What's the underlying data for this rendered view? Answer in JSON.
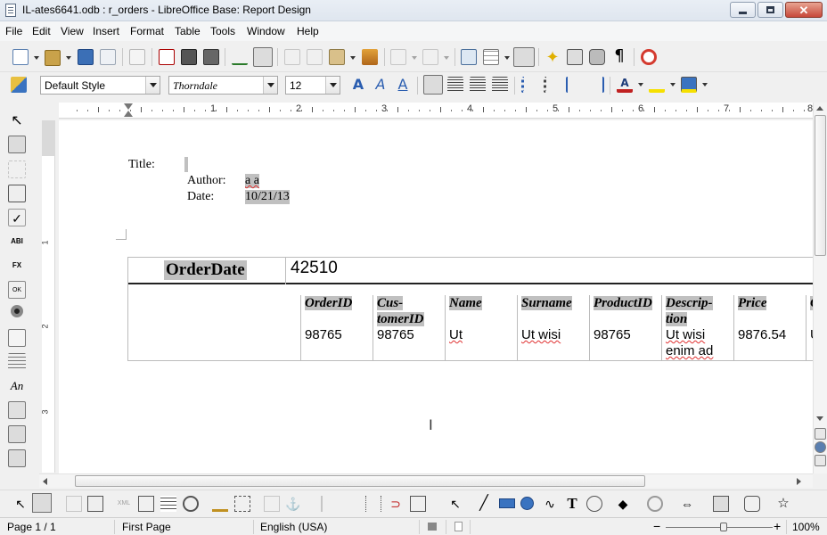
{
  "window": {
    "title": "IL-ates6641.odb : r_orders - LibreOffice Base: Report Design",
    "minimize_label": "",
    "maximize_label": "",
    "close_label": "✕"
  },
  "menu": [
    "File",
    "Edit",
    "View",
    "Insert",
    "Format",
    "Table",
    "Tools",
    "Window",
    "Help"
  ],
  "formatting": {
    "paragraph_style": "Default Style",
    "font_name": "Thorndale",
    "font_size": "12"
  },
  "ruler": {
    "h_numbers": [
      "1",
      "2",
      "3",
      "4",
      "5",
      "6",
      "7",
      "8"
    ],
    "v_numbers": [
      "1",
      "2",
      "3"
    ]
  },
  "page_header": {
    "title_label": "Title:",
    "author_label": "Author:",
    "author_value": "a a",
    "date_label": "Date:",
    "date_value": "10/21/13"
  },
  "group_header": {
    "label": "OrderDate",
    "value": "42510"
  },
  "detail": {
    "columns": [
      {
        "header_line1": "OrderID",
        "header_line2": "",
        "value_line1": "98765",
        "value_line2": ""
      },
      {
        "header_line1": "Cus-",
        "header_line2": "tomerID",
        "value_line1": "98765",
        "value_line2": ""
      },
      {
        "header_line1": "Name",
        "header_line2": "",
        "value_line1": "Ut",
        "value_line2": ""
      },
      {
        "header_line1": "Surname",
        "header_line2": "",
        "value_line1": "Ut wisi",
        "value_line2": ""
      },
      {
        "header_line1": "ProductID",
        "header_line2": "",
        "value_line1": "98765",
        "value_line2": ""
      },
      {
        "header_line1": "Descrip-",
        "header_line2": "tion",
        "value_line1": "Ut wisi",
        "value_line2": "enim ad"
      },
      {
        "header_line1": "Price",
        "header_line2": "",
        "value_line1": "9876.54",
        "value_line2": ""
      },
      {
        "header_line1": "Q",
        "header_line2": "",
        "value_line1": "U",
        "value_line2": ""
      }
    ]
  },
  "status": {
    "page": "Page 1 / 1",
    "page_style": "First Page",
    "language": "English (USA)",
    "zoom": "100%"
  },
  "colors": {
    "field_highlight": "#c0c0c0",
    "spell_error": "#e03030",
    "close_button": "#c7483a"
  }
}
